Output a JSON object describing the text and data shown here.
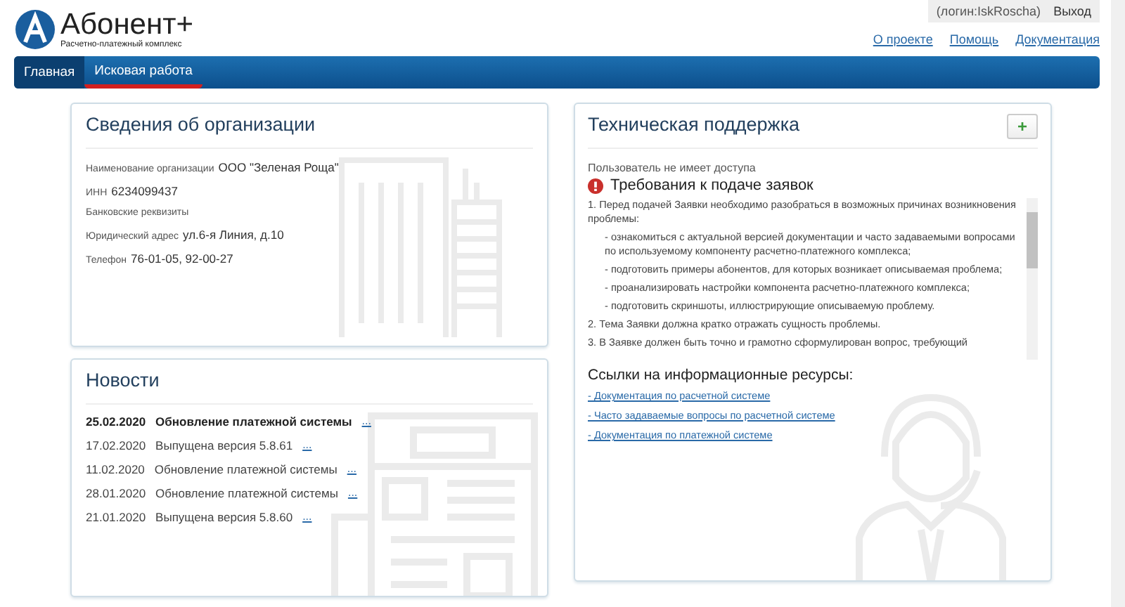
{
  "logo": {
    "name": "Абонент+",
    "subtitle": "Расчетно-платежный комплекс"
  },
  "user": {
    "login": "(логин:IskRoscha)",
    "logout": "Выход"
  },
  "top_links": [
    "О проекте",
    "Помощь",
    "Документация"
  ],
  "nav": [
    {
      "label": "Главная",
      "selected": true,
      "underlined": false
    },
    {
      "label": "Исковая работа",
      "selected": false,
      "underlined": true
    }
  ],
  "organization": {
    "title": "Сведения об организации",
    "fields": [
      {
        "label": "Наименование организации",
        "value": "ООО \"Зеленая Роща\""
      },
      {
        "label": "ИНН",
        "value": "6234099437"
      },
      {
        "label": "Банковские реквизиты"
      },
      {
        "label": "Юридический адрес",
        "value": "ул.6-я Линия, д.10"
      },
      {
        "label": "Телефон",
        "value": "76-01-05, 92-00-27"
      }
    ]
  },
  "news": {
    "title": "Новости",
    "items": [
      {
        "date": "25.02.2020",
        "text": "Обновление платежной системы",
        "more": "...",
        "unread": true
      },
      {
        "date": "17.02.2020",
        "text": "Выпущена версия 5.8.61",
        "more": "...",
        "unread": false
      },
      {
        "date": "11.02.2020",
        "text": "Обновление платежной системы",
        "more": "...",
        "unread": false
      },
      {
        "date": "28.01.2020",
        "text": "Обновление платежной системы",
        "more": "...",
        "unread": false
      },
      {
        "date": "21.01.2020",
        "text": "Выпущена версия 5.8.60",
        "more": "...",
        "unread": false
      }
    ]
  },
  "support": {
    "title": "Техническая поддержка",
    "add_button": "+",
    "access_note": "Пользователь не имеет доступа",
    "requirements_title": "Требования к подаче заявок",
    "requirements": [
      {
        "kind": "item",
        "text": "1. Перед подачей Заявки необходимо разобраться в возможных причинах возникновения проблемы:"
      },
      {
        "kind": "sub",
        "text": "- ознакомиться с актуальной версией документации и часто задаваемыми вопросами по используемому компоненту расчетно-платежного комплекса;"
      },
      {
        "kind": "sub",
        "text": "- подготовить примеры абонентов, для которых возникает описываемая проблема;"
      },
      {
        "kind": "sub",
        "text": "- проанализировать настройки компонента расчетно-платежного комплекса;"
      },
      {
        "kind": "sub",
        "text": "- подготовить скриншоты, иллюстрирующие описываемую проблему."
      },
      {
        "kind": "item",
        "text": "2. Тема Заявки должна кратко отражать сущность проблемы."
      },
      {
        "kind": "item",
        "text": "3. В Заявке должен быть точно и грамотно сформулирован вопрос, требующий"
      }
    ],
    "links_title": "Ссылки на информационные ресурсы:",
    "links": [
      "- Документация по расчетной системе",
      "- Часто задаваемые вопросы по расчетной системе",
      "- Документация по платежной системе"
    ]
  }
}
